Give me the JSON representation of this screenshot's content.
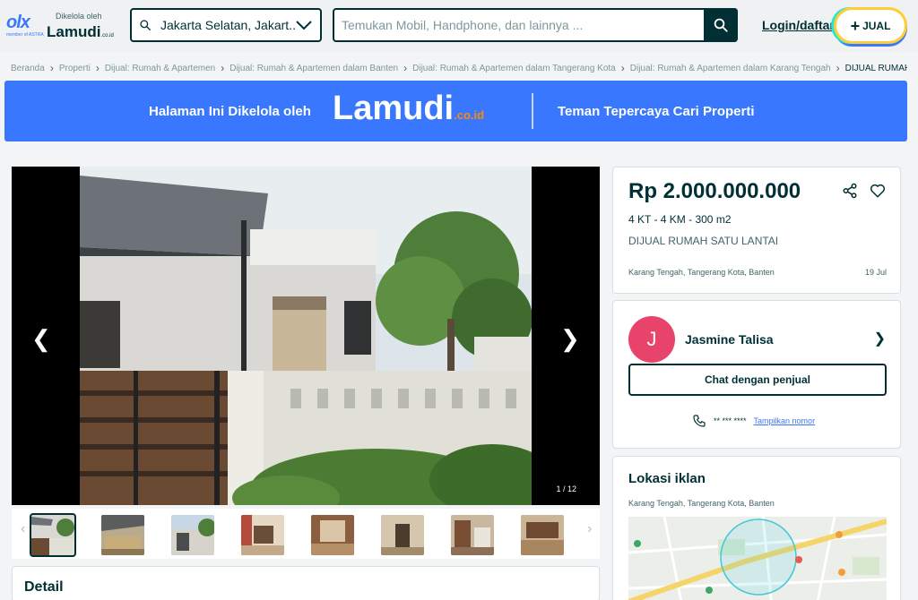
{
  "header": {
    "olx_logo": "olx",
    "olx_sub": "member of ASTRA",
    "managed_by": "Dikelola oleh",
    "lamudi_logo": "Lamudi",
    "lamudi_co": ".co.id",
    "location_value": "Jakarta Selatan, Jakart...",
    "search_placeholder": "Temukan Mobil, Handphone, dan lainnya ...",
    "login_label": "Login/daftar",
    "sell_label": "JUAL"
  },
  "breadcrumb": [
    "Beranda",
    "Properti",
    "Dijual: Rumah & Apartemen",
    "Dijual: Rumah & Apartemen dalam Banten",
    "Dijual: Rumah & Apartemen dalam Tangerang Kota",
    "Dijual: Rumah & Apartemen dalam Karang Tengah",
    "DIJUAL RUMAH SA..."
  ],
  "banner": {
    "left_text": "Halaman Ini Dikelola oleh",
    "brand": "Lamudi",
    "brand_suffix": ".co.id",
    "right_text": "Teman Tepercaya Cari Properti"
  },
  "gallery": {
    "counter": "1 / 12",
    "thumb_count": 8
  },
  "detail": {
    "title": "Detail"
  },
  "listing": {
    "price": "Rp 2.000.000.000",
    "specs": "4 KT - 4 KM - 300 m2",
    "title": "DIJUAL RUMAH SATU LANTAI",
    "location": "Karang Tengah, Tangerang Kota, Banten",
    "date": "19 Jul"
  },
  "seller": {
    "initial": "J",
    "name": "Jasmine Talisa",
    "chat_label": "Chat dengan penjual",
    "phone_masked": "** *** ****",
    "show_number": "Tampilkan nomor"
  },
  "location_card": {
    "title": "Lokasi iklan",
    "address": "Karang Tengah, Tangerang Kota, Banten"
  },
  "colors": {
    "brand_dark": "#002f34",
    "olx_blue": "#3a77ff",
    "lamudi_orange": "#ff8a00",
    "avatar": "#e8436b"
  }
}
